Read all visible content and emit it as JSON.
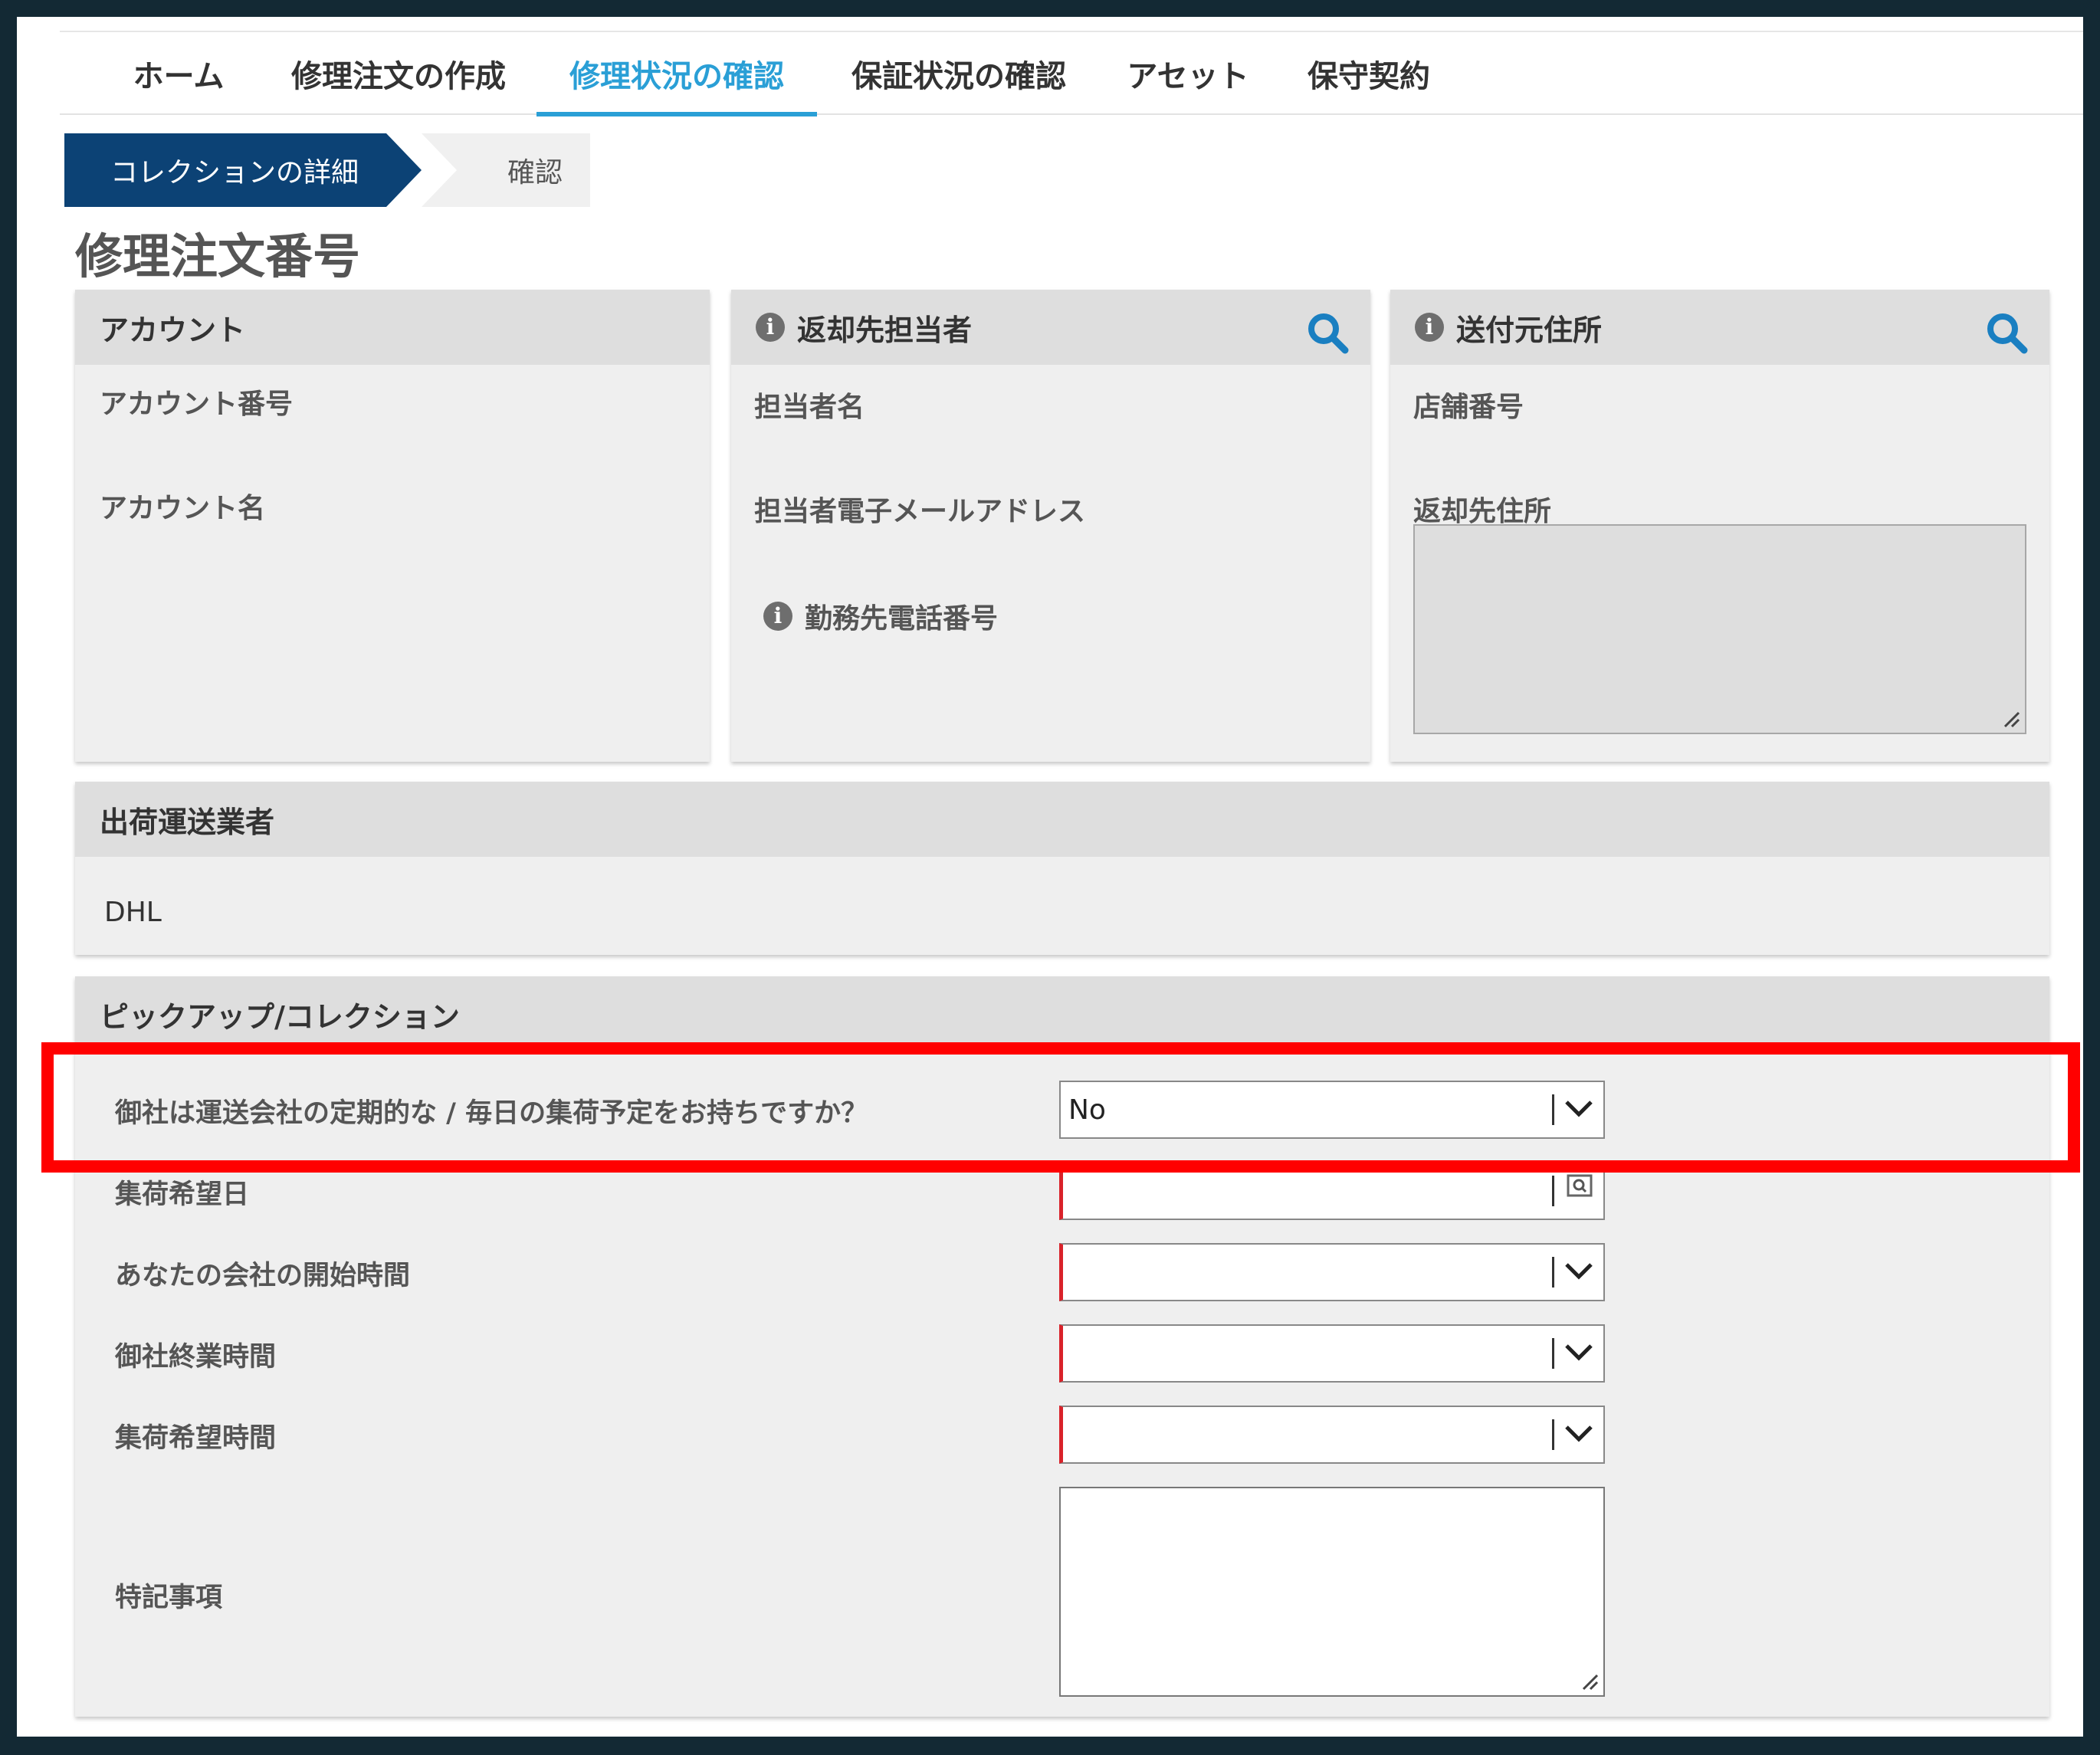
{
  "nav": {
    "tabs": [
      {
        "label": "ホーム"
      },
      {
        "label": "修理注文の作成"
      },
      {
        "label": "修理状況の確認",
        "active": true
      },
      {
        "label": "保証状況の確認"
      },
      {
        "label": "アセット"
      },
      {
        "label": "保守契約"
      }
    ],
    "active_color": "#2a9fd6"
  },
  "stepper": {
    "steps": [
      {
        "label": "コレクションの詳細",
        "active": true
      },
      {
        "label": "確認"
      }
    ],
    "active_color": "#0c4275"
  },
  "page_title": "修理注文番号",
  "account_panel": {
    "title": "アカウント",
    "fields": [
      "アカウント番号",
      "アカウント名"
    ]
  },
  "return_contact_panel": {
    "title": "返却先担当者",
    "fields": [
      "担当者名",
      "担当者電子メールアドレス",
      "勤務先電話番号"
    ]
  },
  "ship_from_panel": {
    "title": "送付元住所",
    "fields": [
      "店舗番号",
      "返却先住所"
    ]
  },
  "carrier_panel": {
    "title": "出荷運送業者",
    "value": "DHL"
  },
  "pickup_panel": {
    "title": "ピックアップ/コレクション",
    "fields": {
      "scheduled_pickup": {
        "label": "御社は運送会社の定期的な / 毎日の集荷予定をお持ちですか？",
        "value": "No"
      },
      "pickup_date": {
        "label": "集荷希望日",
        "value": ""
      },
      "open_time": {
        "label": "あなたの会社の開始時間",
        "value": ""
      },
      "close_time": {
        "label": "御社終業時間",
        "value": ""
      },
      "pickup_time": {
        "label": "集荷希望時間",
        "value": ""
      },
      "notes": {
        "label": "特記事項",
        "value": ""
      }
    }
  },
  "colors": {
    "required_marker": "#d9222a",
    "highlight": "#ff0000",
    "search_icon": "#1a7fc1"
  }
}
